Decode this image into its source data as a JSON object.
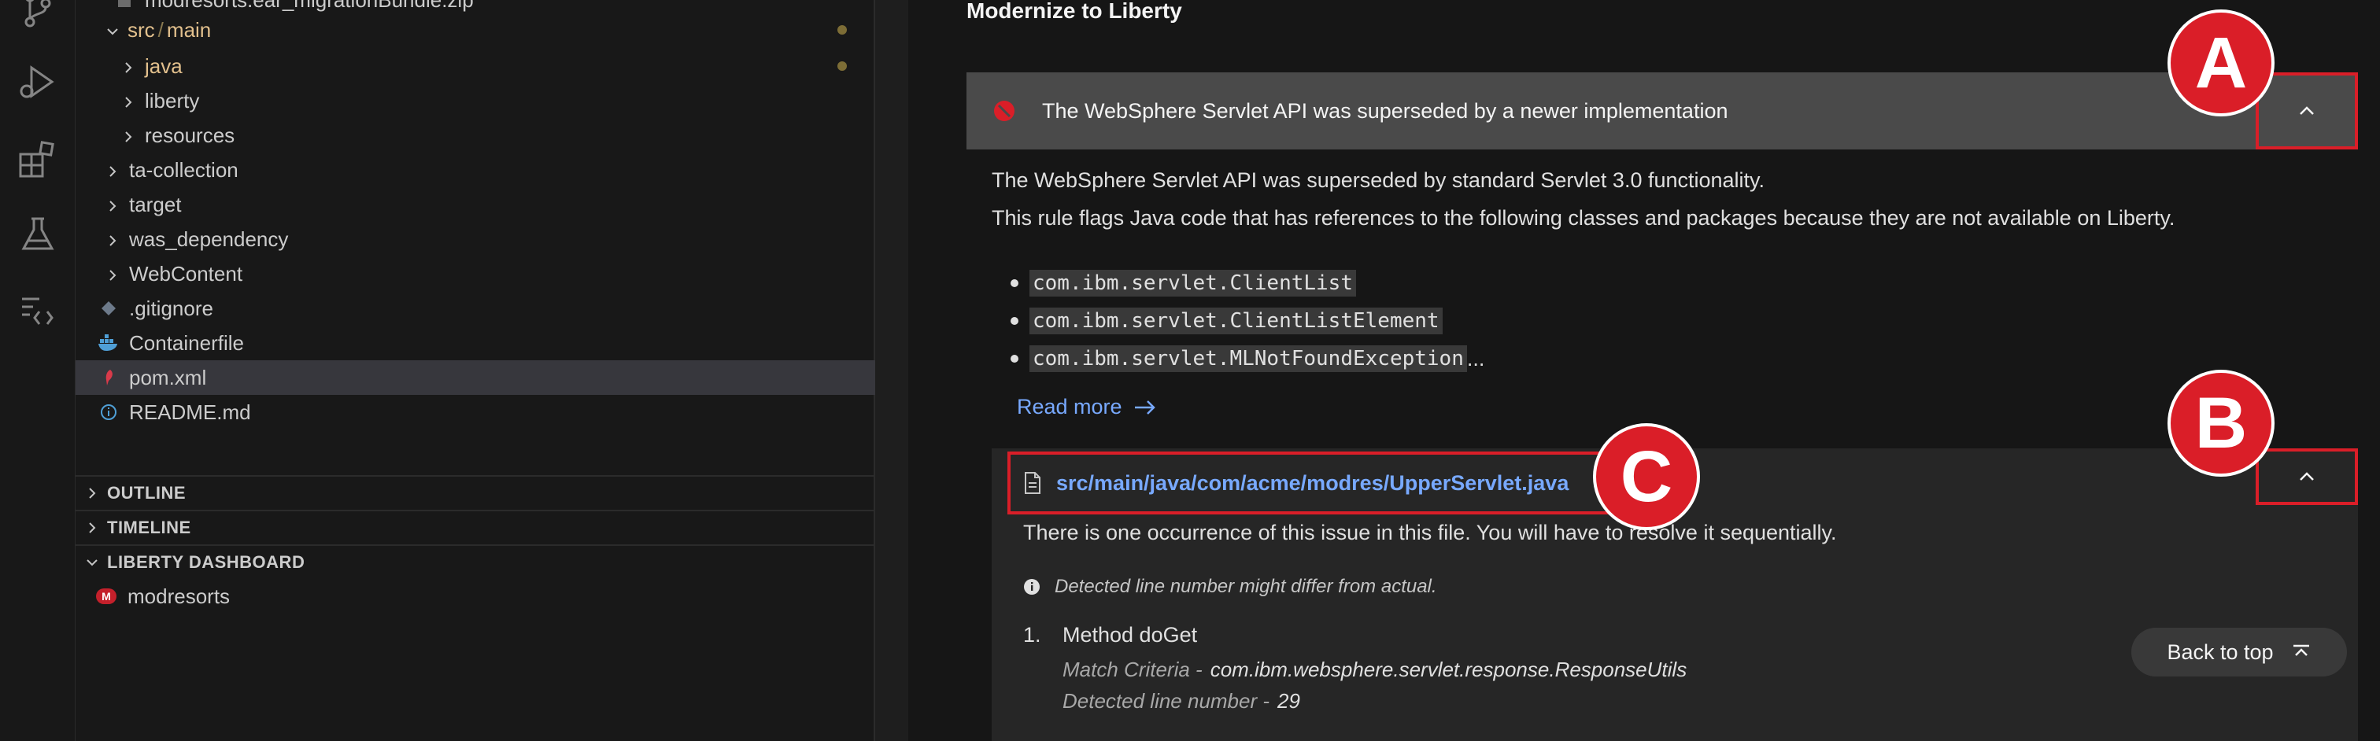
{
  "sidebar": {
    "tree": [
      {
        "label": "modresorts.ear_migrationBundle.zip",
        "type": "file"
      },
      {
        "label_a": "src",
        "sep": "/",
        "label_b": "main",
        "type": "folder-open"
      },
      {
        "label": "java",
        "type": "folder"
      },
      {
        "label": "liberty",
        "type": "folder"
      },
      {
        "label": "resources",
        "type": "folder"
      },
      {
        "label": "ta-collection",
        "type": "folder"
      },
      {
        "label": "target",
        "type": "folder"
      },
      {
        "label": "was_dependency",
        "type": "folder"
      },
      {
        "label": "WebContent",
        "type": "folder"
      },
      {
        "label": ".gitignore",
        "type": "file"
      },
      {
        "label": "Containerfile",
        "type": "file"
      },
      {
        "label": "pom.xml",
        "type": "file",
        "selected": true
      },
      {
        "label": "README.md",
        "type": "file"
      }
    ],
    "sections": {
      "outline": "OUTLINE",
      "timeline": "TIMELINE",
      "liberty_dashboard": "LIBERTY DASHBOARD"
    },
    "dashboard_project": {
      "label": "modresorts",
      "badge": "M"
    }
  },
  "panel": {
    "title": "Modernize to Liberty",
    "issue": {
      "title": "The WebSphere Servlet API was superseded by a newer implementation",
      "desc1": "The WebSphere Servlet API was superseded by standard Servlet 3.0 functionality.",
      "desc2": "This rule flags Java code that has references to the following classes and packages because they are not available on Liberty.",
      "classes": [
        "com.ibm.servlet.ClientList",
        "com.ibm.servlet.ClientListElement",
        "com.ibm.servlet.MLNotFoundException"
      ],
      "ellipsis": "...",
      "read_more": "Read more"
    },
    "file": {
      "path": "src/main/java/com/acme/modres/UpperServlet.java",
      "occurrence": "There is one occurrence of this issue in this file. You will have to resolve it sequentially.",
      "note": "Detected line number might differ from actual.",
      "method_num": "1.",
      "method": "Method doGet",
      "match_label": "Match Criteria -",
      "match_value": "com.ibm.websphere.servlet.response.ResponseUtils",
      "line_label": "Detected line number -",
      "line_value": "29"
    },
    "back_to_top": "Back to top"
  },
  "annotations": {
    "a": "A",
    "b": "B",
    "c": "C"
  },
  "colors": {
    "accent_red": "#da1e28",
    "link_blue": "#78a9ff",
    "folder_yellow": "#e2c08d"
  }
}
